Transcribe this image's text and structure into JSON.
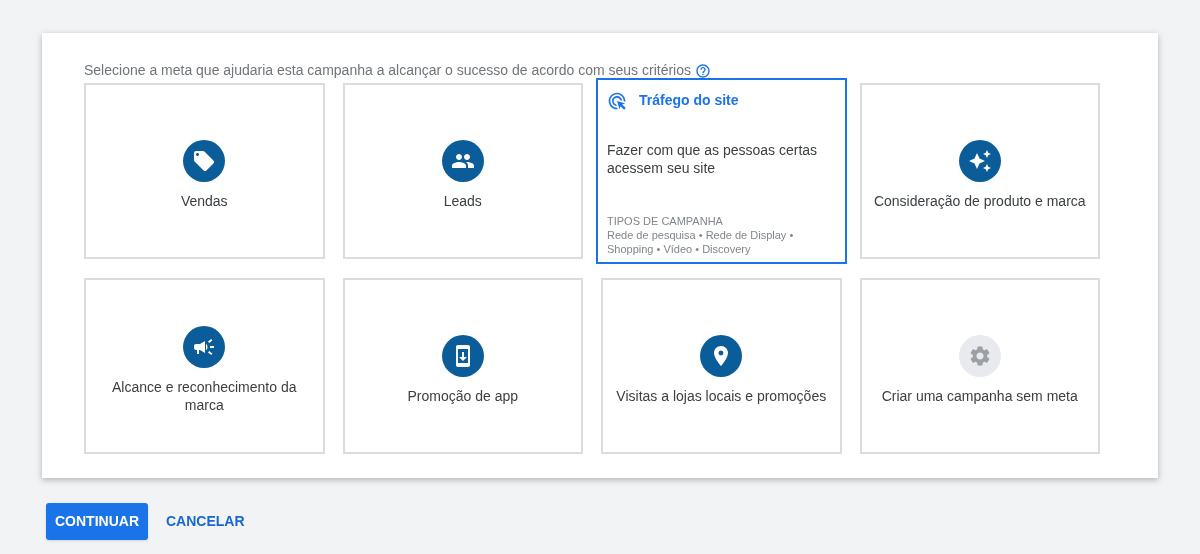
{
  "prompt": {
    "text": "Selecione a meta que ajudaria esta campanha a alcançar o sucesso de acordo com seus critérios"
  },
  "goals": [
    {
      "label": "Vendas",
      "selected": false,
      "muted": false
    },
    {
      "label": "Leads",
      "selected": false,
      "muted": false
    },
    {
      "label": "Tráfego do site",
      "selected": true,
      "muted": false,
      "description": "Fazer com que as pessoas certas acessem seu site",
      "types_heading": "TIPOS DE CAMPANHA",
      "types": "Rede de pesquisa • Rede de Display • Shopping • Vídeo • Discovery"
    },
    {
      "label": "Consideração de produto e marca",
      "selected": false,
      "muted": false
    },
    {
      "label": "Alcance e reconhecimento da marca",
      "selected": false,
      "muted": false
    },
    {
      "label": "Promoção de app",
      "selected": false,
      "muted": false
    },
    {
      "label": "Visitas a lojas locais e promoções",
      "selected": false,
      "muted": false
    },
    {
      "label": "Criar uma campanha sem meta",
      "selected": false,
      "muted": true
    }
  ],
  "buttons": {
    "primary": "CONTINUAR",
    "secondary": "CANCELAR"
  }
}
